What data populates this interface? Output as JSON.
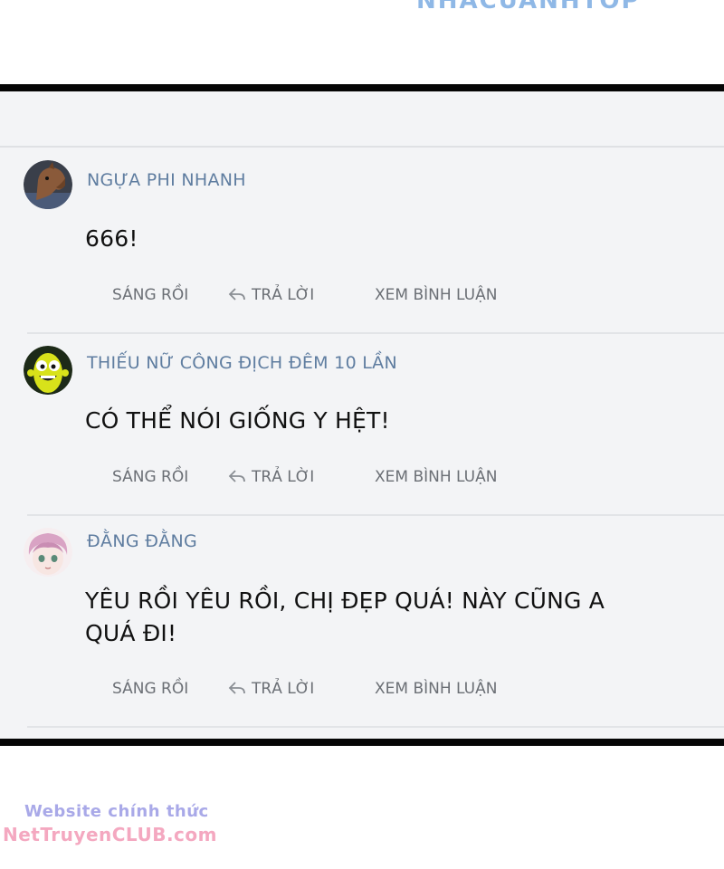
{
  "watermark_top": "NHACUANHTOP",
  "comments": [
    {
      "username": "NGỰA PHI NHANH",
      "avatar": "horse-avatar-icon",
      "text": "666!",
      "actions": {
        "time": "SÁNG RỒI",
        "reply": "TRẢ LỜI",
        "view": "XEM BÌNH LUẬN"
      }
    },
    {
      "username": "THIẾU NỮ CÔNG ĐỊCH ĐÊM 10 LẦN",
      "avatar": "yellow-creature-avatar-icon",
      "text": "CÓ THỂ NÓI GIỐNG Y HỆT!",
      "actions": {
        "time": "SÁNG RỒI",
        "reply": "TRẢ LỜI",
        "view": "XEM BÌNH LUẬN"
      }
    },
    {
      "username": "ĐẰNG ĐẰNG",
      "avatar": "anime-girl-avatar-icon",
      "text": "YÊU RỒI YÊU RỒI, CHỊ ĐẸP QUÁ! NÀY CŨNG A QUÁ ĐI!",
      "actions": {
        "time": "SÁNG RỒI",
        "reply": "TRẢ LỜI",
        "view": "XEM BÌNH LUẬN"
      }
    }
  ],
  "footer": {
    "line1": "Website chính thức",
    "line2": "NetTruyenCLUB.com"
  },
  "colors": {
    "username": "#5f7da0",
    "panel_bg": "#f3f4f6",
    "border": "#050505",
    "footer_line1": "#a9a9e8",
    "footer_line2": "#f4a8c0"
  }
}
